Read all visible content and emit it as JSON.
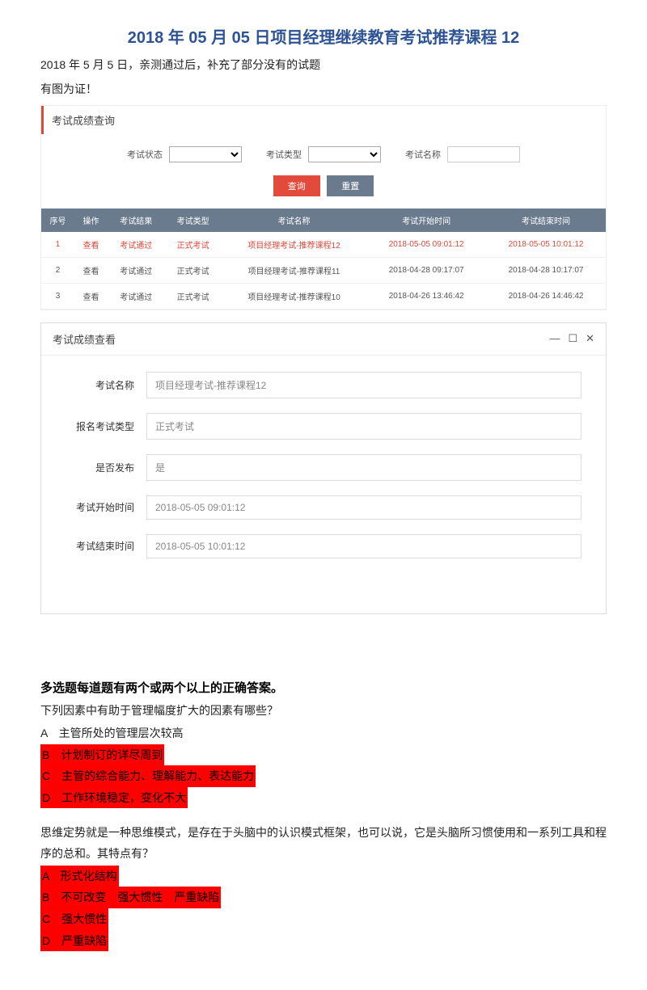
{
  "title": "2018 年 05 月 05 日项目经理继续教育考试推荐课程 12",
  "intro1": "2018 年 5 月 5 日，亲测通过后，补充了部分没有的试题",
  "intro2": "有图为证！",
  "panel": {
    "header": "考试成绩查询",
    "search": {
      "status_label": "考试状态",
      "type_label": "考试类型",
      "name_label": "考试名称",
      "query_btn": "查询",
      "reset_btn": "重置"
    },
    "table": {
      "headers": [
        "序号",
        "操作",
        "考试结果",
        "考试类型",
        "考试名称",
        "考试开始时间",
        "考试结束时间"
      ],
      "rows": [
        {
          "seq": "1",
          "op": "查看",
          "result": "考试通过",
          "type": "正式考试",
          "name": "项目经理考试-推荐课程12",
          "start": "2018-05-05 09:01:12",
          "end": "2018-05-05 10:01:12",
          "selected": true
        },
        {
          "seq": "2",
          "op": "查看",
          "result": "考试通过",
          "type": "正式考试",
          "name": "项目经理考试-推荐课程11",
          "start": "2018-04-28 09:17:07",
          "end": "2018-04-28 10:17:07",
          "selected": false
        },
        {
          "seq": "3",
          "op": "查看",
          "result": "考试通过",
          "type": "正式考试",
          "name": "项目经理考试-推荐课程10",
          "start": "2018-04-26 13:46:42",
          "end": "2018-04-26 14:46:42",
          "selected": false
        }
      ]
    }
  },
  "detail": {
    "header": "考试成绩查看",
    "min_icon": "—",
    "max_icon": "☐",
    "close_icon": "✕",
    "fields": [
      {
        "label": "考试名称",
        "value": "项目经理考试-推荐课程12"
      },
      {
        "label": "报名考试类型",
        "value": "正式考试"
      },
      {
        "label": "是否发布",
        "value": "是"
      },
      {
        "label": "考试开始时间",
        "value": "2018-05-05 09:01:12"
      },
      {
        "label": "考试结束时间",
        "value": "2018-05-05 10:01:12"
      }
    ]
  },
  "section_heading": "多选题每道题有两个或两个以上的正确答案。",
  "questions": [
    {
      "text": "下列因素中有助于管理幅度扩大的因素有哪些？",
      "options": [
        {
          "t": "A　主管所处的管理层次较高",
          "hl": false
        },
        {
          "t": "B　计划制订的详尽周到",
          "hl": true
        },
        {
          "t": "C　主管的综合能力、理解能力、表达能力",
          "hl": true
        },
        {
          "t": "D　工作环境稳定，变化不大",
          "hl": true
        }
      ]
    },
    {
      "text": "思维定势就是一种思维模式，是存在于头脑中的认识模式框架，也可以说，它是头脑所习惯使用和一系列工具和程序的总和。其特点有？",
      "options": [
        {
          "t": "A　形式化结构",
          "hl": true
        },
        {
          "t": "B　不可改变　强大惯性　严重缺陷",
          "hl": true
        },
        {
          "t": "C　强大惯性",
          "hl": true
        },
        {
          "t": "D　严重缺陷",
          "hl": true
        }
      ]
    }
  ]
}
